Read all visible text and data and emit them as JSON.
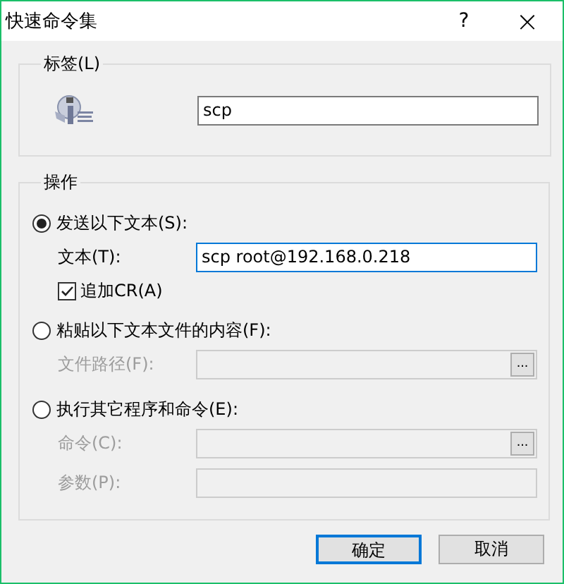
{
  "window": {
    "title": "快速命令集",
    "help": "?",
    "close": "×"
  },
  "label_group": {
    "title": "标签(L)",
    "value": "scp"
  },
  "action_group": {
    "title": "操作",
    "options": [
      {
        "label": "发送以下文本(S):",
        "selected": true,
        "items": [
          {
            "kind": "field",
            "label": "文本(T):",
            "value": "scp root@192.168.0.218",
            "disabled": false,
            "focused": true
          },
          {
            "kind": "checkbox",
            "label": "追加CR(A)",
            "checked": true,
            "disabled": false
          }
        ]
      },
      {
        "label": "粘贴以下文本文件的内容(F):",
        "selected": false,
        "items": [
          {
            "kind": "field",
            "label": "文件路径(F):",
            "value": "",
            "disabled": true,
            "focused": false,
            "browse": "..."
          }
        ]
      },
      {
        "label": "执行其它程序和命令(E):",
        "selected": false,
        "items": [
          {
            "kind": "field",
            "label": "命令(C):",
            "value": "",
            "disabled": true,
            "focused": false,
            "browse": "..."
          },
          {
            "kind": "field",
            "label": "参数(P):",
            "value": "",
            "disabled": true,
            "focused": false
          }
        ]
      }
    ]
  },
  "buttons": [
    {
      "label": "确定",
      "default": true
    },
    {
      "label": "取消",
      "default": false
    }
  ]
}
